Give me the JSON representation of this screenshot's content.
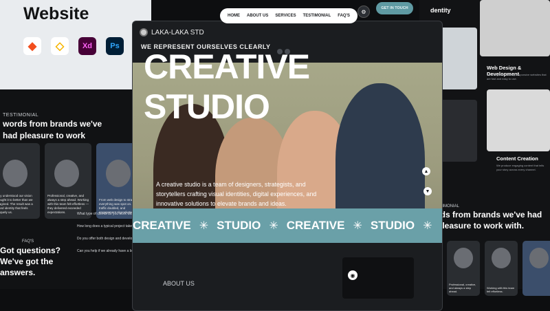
{
  "promo": {
    "title_line": "Website",
    "tools": [
      {
        "icon": "figma-icon",
        "glyph": "◆"
      },
      {
        "icon": "sketch-icon",
        "glyph": "◇"
      },
      {
        "icon": "xd-icon",
        "glyph": "Xd"
      },
      {
        "icon": "photoshop-icon",
        "glyph": "Ps"
      }
    ]
  },
  "left_panel": {
    "eyebrow": "TESTIMONIAL",
    "heading": "words from brands we've had pleasure to work with.",
    "cards": [
      {
        "text": "truly understood our vision brought it to better than we imagined. The result was a brand identity that feels uniquely us."
      },
      {
        "text": "Professional, creative, and always a step ahead. Working with this team felt effortless — they delivered exceeded expectations."
      },
      {
        "text": "From web design to strategy, everything was spot on. Our traffic doubled, and engagement skyrocketed."
      }
    ],
    "faq_label": "FAQ'S",
    "faq_heading": "Got questions? We've got the answers.",
    "questions": [
      "What type of clients do you work with?",
      "How long does a typical project take?",
      "Do you offer both design and development?",
      "Can you help if we already have a brand?"
    ]
  },
  "main": {
    "brand": "LAKA-LAKA STD",
    "nav": [
      "HOME",
      "ABOUT US",
      "SERVICES",
      "TESTIMONIAL",
      "FAQ'S"
    ],
    "tagline": "WE REPRESENT OURSELVES CLEARLY",
    "hero_title": "CREATIVE STUDIO",
    "hero_desc": "A creative studio is a team of designers, strategists, and storytellers crafting visual identities, digital experiences, and innovative solutions to elevate brands and ideas.",
    "marquee": [
      "CREATIVE",
      "STUDIO",
      "CREATIVE",
      "STUDIO"
    ],
    "marquee_star": "✳",
    "about_label": "ABOUT US",
    "cta_label": "GET IN TOUCH"
  },
  "right_panel": {
    "heading": "dentity",
    "items": [
      {
        "label": "Web Design & Development",
        "sub": "We design and develop responsive websites that are fast and easy to use."
      },
      {
        "label": "Content Creation",
        "sub": "We produce engaging content that tells your story across every channel."
      }
    ],
    "testimonial_eyebrow": "TESTIMONIAL",
    "testimonial_heading": "rds from brands we've had pleasure to work with.",
    "cards": [
      {
        "text": "Professional, creative, and always a step ahead."
      },
      {
        "text": "Working with this team felt effortless."
      }
    ]
  }
}
